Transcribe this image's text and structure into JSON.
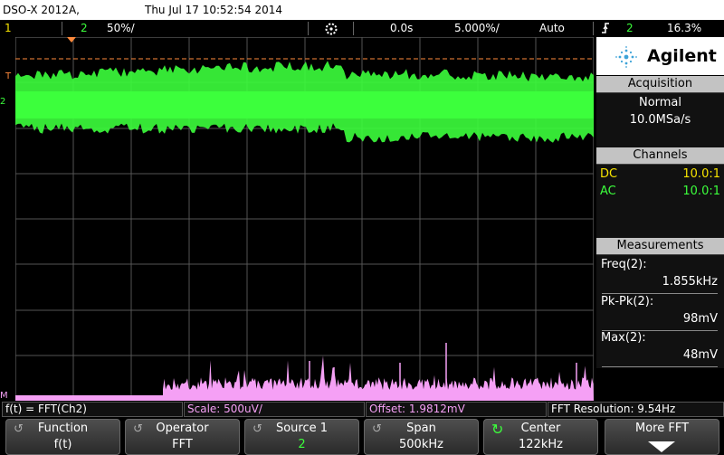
{
  "titlebar": {
    "model": "DSO-X 2012A,",
    "datetime": "Thu Jul 17 10:52:54 2014"
  },
  "status": {
    "ch1": "1",
    "ch2": "2",
    "ch2_scale": "50%/",
    "time_delay": "0.0s",
    "time_scale": "5.000%/",
    "trigger_mode": "Auto",
    "trigger_src": "2",
    "trigger_level": "16.3%"
  },
  "brand": "Agilent",
  "acquisition": {
    "header": "Acquisition",
    "mode": "Normal",
    "rate": "10.0MSa/s"
  },
  "channels": {
    "header": "Channels",
    "rows": [
      {
        "coupling": "DC",
        "probe": "10.0:1",
        "color": "#f7e400"
      },
      {
        "coupling": "AC",
        "probe": "10.0:1",
        "color": "#3cff3c"
      }
    ]
  },
  "measurements": {
    "header": "Measurements",
    "items": [
      {
        "label": "Freq(2):",
        "value": "1.855kHz"
      },
      {
        "label": "Pk-Pk(2):",
        "value": "98mV"
      },
      {
        "label": "Max(2):",
        "value": "48mV"
      }
    ]
  },
  "markers": {
    "trigger": "T",
    "ch2": "2",
    "math": "M"
  },
  "info": {
    "func": "f(t) = FFT(Ch2)",
    "scale": "Scale: 500uV/",
    "offset": "Offset: 1.9812mV",
    "resolution": "FFT Resolution: 9.54Hz"
  },
  "softkeys": [
    {
      "label": "Function",
      "value": "f(t)"
    },
    {
      "label": "Operator",
      "value": "FFT"
    },
    {
      "label": "Source 1",
      "value": "2"
    },
    {
      "label": "Span",
      "value": "500kHz"
    },
    {
      "label": "Center",
      "value": "122kHz"
    },
    {
      "label": "More FFT",
      "value": ""
    }
  ],
  "colors": {
    "ch1": "#f7e400",
    "ch2": "#3cff3c",
    "math": "#f5a0f5",
    "trigger_line": "#ff8a3c",
    "header_gray": "#c3c3c3"
  },
  "icons": {
    "run_stop": "gear-like-icon",
    "rotate": "rotate-icon",
    "more": "down-arrow-icon",
    "logo": "agilent-spark-icon"
  }
}
